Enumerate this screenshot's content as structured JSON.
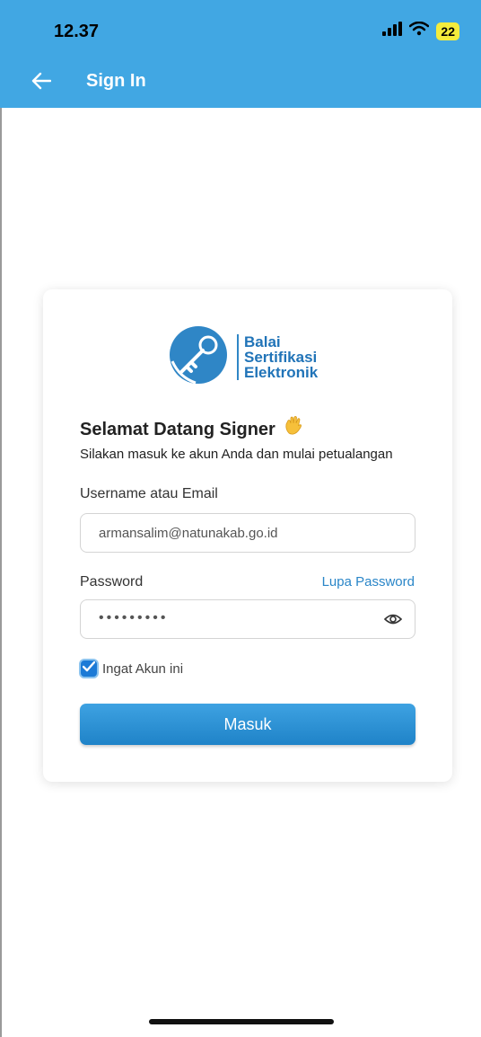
{
  "status_bar": {
    "time": "12.37",
    "battery": "22"
  },
  "app_bar": {
    "title": "Sign In"
  },
  "logo": {
    "line1": "Balai",
    "line2": "Sertifikasi",
    "line3": "Elektronik"
  },
  "login": {
    "welcome": "Selamat Datang Signer",
    "subtitle": "Silakan masuk ke akun Anda dan mulai petualangan",
    "username_label": "Username atau Email",
    "username_value": "armansalim@natunakab.go.id",
    "password_label": "Password",
    "forgot_label": "Lupa Password",
    "password_mask": "•••••••••",
    "remember_label": "Ingat Akun ini",
    "remember_checked": true,
    "submit_label": "Masuk"
  },
  "colors": {
    "primary": "#41a7e3",
    "button": "#2a8fd4",
    "link": "#2a86c8",
    "checkbox": "#1c7ad6"
  },
  "icons": {
    "back": "arrow-left-icon",
    "signal": "signal-icon",
    "wifi": "wifi-icon",
    "eye": "eye-icon",
    "wave": "waving-hand-icon",
    "check": "check-icon"
  }
}
